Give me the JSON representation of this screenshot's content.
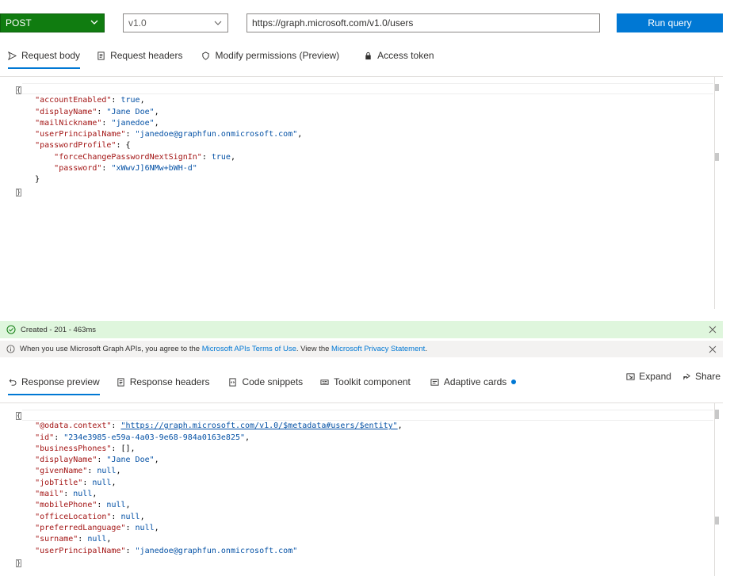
{
  "query": {
    "method": "POST",
    "version": "v1.0",
    "url": "https://graph.microsoft.com/v1.0/users",
    "run_label": "Run query"
  },
  "request_tabs": [
    {
      "label": "Request body",
      "icon": "send-icon"
    },
    {
      "label": "Request headers",
      "icon": "document-icon"
    },
    {
      "label": "Modify permissions (Preview)",
      "icon": "shield-icon"
    },
    {
      "label": "Access token",
      "icon": "lock-icon"
    }
  ],
  "request_body": [
    "{",
    "    \"accountEnabled\": true,",
    "    \"displayName\": \"Jane Doe\",",
    "    \"mailNickname\": \"janedoe\",",
    "    \"userPrincipalName\": \"janedoe@graphfun.onmicrosoft.com\",",
    "    \"passwordProfile\": {",
    "        \"forceChangePasswordNextSignIn\": true,",
    "        \"password\": \"xWwvJ]6NMw+bWH-d\"",
    "    }",
    "}"
  ],
  "status": {
    "text": "Created - 201 - 463ms",
    "color": "#dff6dd"
  },
  "info": {
    "prefix": "When you use Microsoft Graph APIs, you agree to the",
    "terms_link": "Microsoft APIs Terms of Use",
    "middle": ". View the",
    "privacy_link": "Microsoft Privacy Statement",
    "suffix": "."
  },
  "response_tabs": [
    {
      "label": "Response preview",
      "icon": "undo-icon"
    },
    {
      "label": "Response headers",
      "icon": "document-icon"
    },
    {
      "label": "Code snippets",
      "icon": "code-icon"
    },
    {
      "label": "Toolkit component",
      "icon": "toolkit-icon"
    },
    {
      "label": "Adaptive cards",
      "icon": "card-icon"
    }
  ],
  "response_actions": {
    "expand": "Expand",
    "share": "Share"
  },
  "response_body": {
    "odata_key": "\"@odata.context\"",
    "odata_value": "\"https://graph.microsoft.com/v1.0/$metadata#users/$entity\"",
    "lines": [
      {
        "key": "\"id\"",
        "value": "\"234e3985-e59a-4a03-9e68-984a0163e825\"",
        "type": "s"
      },
      {
        "key": "\"businessPhones\"",
        "value": "[]",
        "type": "p"
      },
      {
        "key": "\"displayName\"",
        "value": "\"Jane Doe\"",
        "type": "s"
      },
      {
        "key": "\"givenName\"",
        "value": "null",
        "type": "b"
      },
      {
        "key": "\"jobTitle\"",
        "value": "null",
        "type": "b"
      },
      {
        "key": "\"mail\"",
        "value": "null",
        "type": "b"
      },
      {
        "key": "\"mobilePhone\"",
        "value": "null",
        "type": "b"
      },
      {
        "key": "\"officeLocation\"",
        "value": "null",
        "type": "b"
      },
      {
        "key": "\"preferredLanguage\"",
        "value": "null",
        "type": "b"
      },
      {
        "key": "\"surname\"",
        "value": "null",
        "type": "b"
      },
      {
        "key": "\"userPrincipalName\"",
        "value": "\"janedoe@graphfun.onmicrosoft.com\"",
        "type": "s",
        "last": true
      }
    ]
  }
}
